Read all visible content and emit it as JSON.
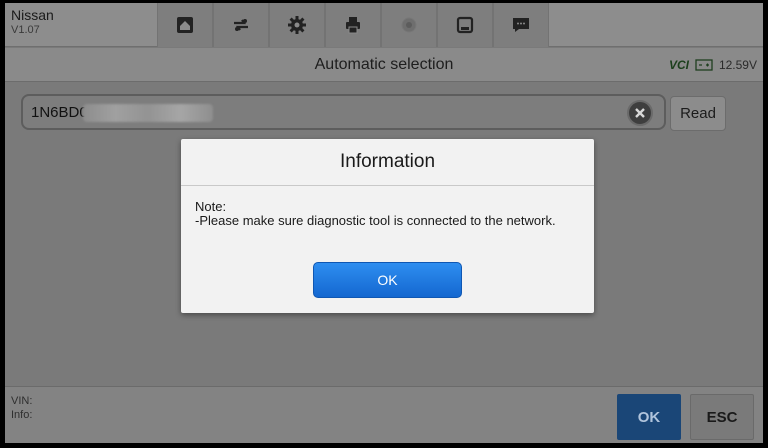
{
  "app": {
    "name": "Nissan",
    "version": "V1.07"
  },
  "toolbar": {
    "icons": [
      "home-icon",
      "vehicle-swap-icon",
      "gear-icon",
      "print-icon",
      "camera-icon",
      "save-icon",
      "chat-icon"
    ]
  },
  "header": {
    "title": "Automatic selection",
    "vci_label": "VCI",
    "voltage": "12.59V"
  },
  "vin_input": {
    "value": "1N6BD0"
  },
  "read_button": {
    "label": "Read"
  },
  "dialog": {
    "title": "Information",
    "note_label": "Note:",
    "message": "-Please make sure diagnostic tool is connected to the network.",
    "ok_label": "OK"
  },
  "bottom": {
    "vin_label": "VIN:",
    "info_label": "Info:",
    "ok_label": "OK",
    "esc_label": "ESC"
  },
  "colors": {
    "dialog_ok": "#1e78e0",
    "bottom_ok": "#1a4677",
    "vci_label": "#1b3f1b"
  }
}
